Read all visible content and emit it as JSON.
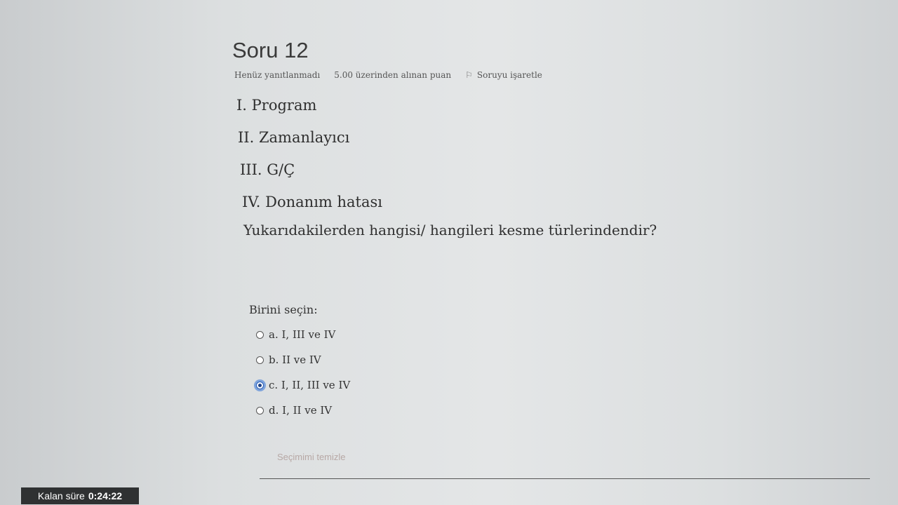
{
  "question": {
    "number": "Soru 12",
    "status": "Henüz yanıtlanmadı",
    "points": "5.00 üzerinden alınan puan",
    "flag_label": "Soruyu işaretle",
    "flag_icon": "flag-icon",
    "items": [
      "I. Program",
      "II. Zamanlayıcı",
      "III. G/Ç",
      "IV. Donanım hatası"
    ],
    "prompt": "Yukarıdakilerden hangisi/ hangileri kesme türlerindendir?"
  },
  "answer": {
    "select_label": "Birini seçin:",
    "options": [
      {
        "label": "a. I, III ve IV",
        "selected": false
      },
      {
        "label": "b. II ve IV",
        "selected": false
      },
      {
        "label": "c. I, II, III ve IV",
        "selected": true
      },
      {
        "label": "d. I, II ve IV",
        "selected": false
      }
    ],
    "clear_label": "Seçimimi temizle"
  },
  "timer": {
    "label": "Kalan süre",
    "value": "0:24:22"
  },
  "colors": {
    "accent": "#2b5fb8",
    "timer_bg": "#2f3132"
  }
}
